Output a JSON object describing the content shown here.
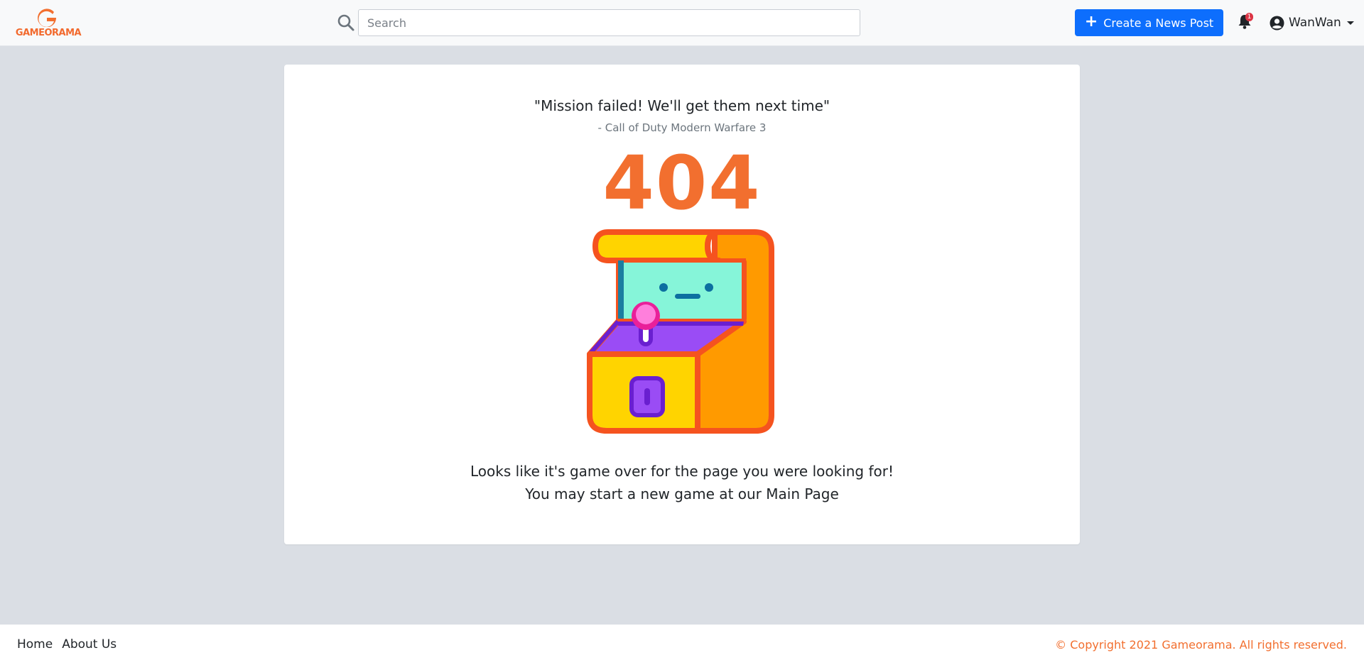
{
  "brand": {
    "name": "GAMEORAMA",
    "accent_color": "#f26f2f"
  },
  "header": {
    "search": {
      "placeholder": "Search",
      "value": ""
    },
    "create_button": {
      "icon": "plus-icon",
      "label": "Create a News Post",
      "color": "#0d6efd"
    },
    "notifications": {
      "icon": "bell-icon",
      "count": "1",
      "badge_color": "#dc3545"
    },
    "user": {
      "icon": "user-circle-icon",
      "name": "WanWan"
    }
  },
  "error_page": {
    "quote": "\"Mission failed! We'll get them next time\"",
    "quote_source": "- Call of Duty Modern Warfare 3",
    "code": "404",
    "illustration": "arcade-machine-icon",
    "message_line1": "Looks like it's game over for the page you were looking for!",
    "message_line2_prefix": "You may start a new game at our ",
    "message_link": "Main Page"
  },
  "footer": {
    "links": [
      {
        "label": "Home"
      },
      {
        "label": "About Us"
      }
    ],
    "copyright": "© Copyright 2021 Gameorama. All rights reserved."
  }
}
